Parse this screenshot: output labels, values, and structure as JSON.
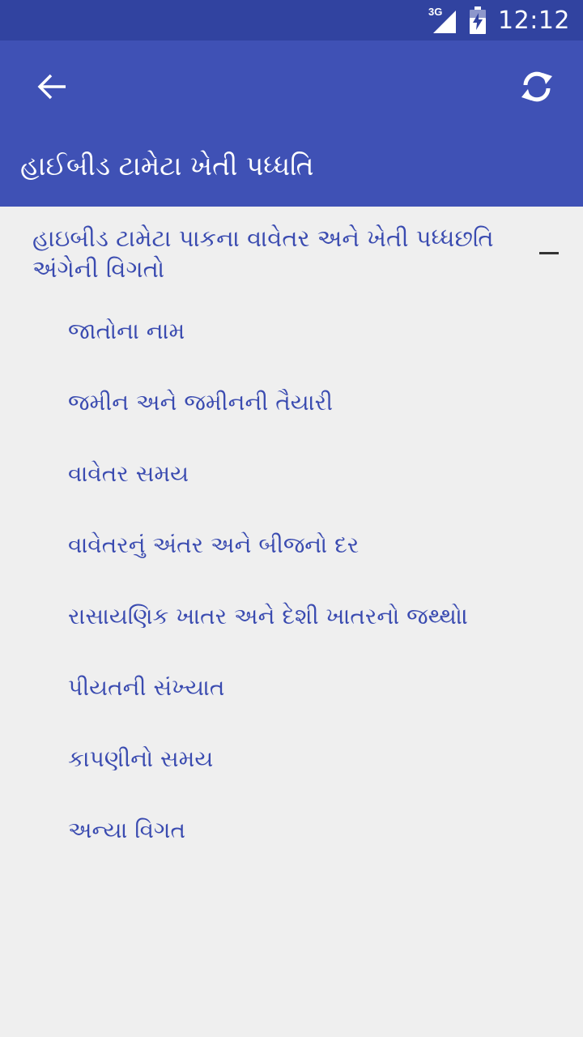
{
  "status_bar": {
    "network": "3G",
    "time": "12:12"
  },
  "app_bar": {
    "back_icon": "arrow-left-icon",
    "refresh_icon": "refresh-icon",
    "title": "હાઈબીડ ટામેટા ખેતી પધ્ધતિ"
  },
  "group": {
    "title": "હાઇબીડ ટામેટા પાકના વાવેતર અને ખેતી પધ્ધછતિ અંગેની વિગતો",
    "collapse_icon": "minus-icon"
  },
  "items": [
    {
      "label": "જાતોના નામ"
    },
    {
      "label": "જમીન અને જમીનની તૈયારી"
    },
    {
      "label": "વાવેતર સમય"
    },
    {
      "label": "વાવેતરનું અંતર અને બીજનો દર"
    },
    {
      "label": "રાસાયણિક ખાતર અને દેશી ખાતરનો જથ્થો।"
    },
    {
      "label": "પીયતની સંખ્યાત"
    },
    {
      "label": "કાપણીનો સમય"
    },
    {
      "label": "અન્યા વિગત"
    }
  ],
  "colors": {
    "status_bar": "#3143a0",
    "app_bar": "#3f51b5",
    "background": "#efefef",
    "link_text": "#3a4bb0"
  }
}
